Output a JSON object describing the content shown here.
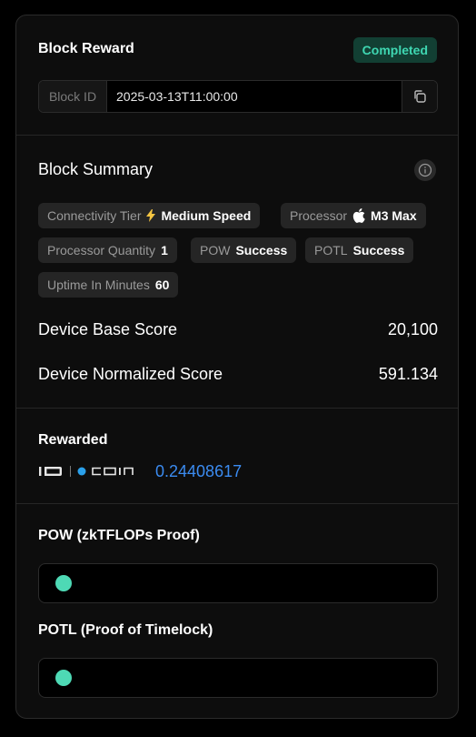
{
  "header": {
    "title": "Block Reward",
    "status": "Completed",
    "block_id_label": "Block ID",
    "block_id_value": "2025-03-13T11:00:00"
  },
  "summary": {
    "title": "Block Summary",
    "tags": [
      {
        "key": "Connectivity Tier",
        "icon": "lightning-icon",
        "value": "Medium Speed"
      },
      {
        "key": "Processor",
        "icon": "apple-icon",
        "value": "M3 Max"
      },
      {
        "key": "Processor Quantity",
        "value": "1"
      },
      {
        "key": "POW",
        "value": "Success"
      },
      {
        "key": "POTL",
        "value": "Success"
      },
      {
        "key": "Uptime In Minutes",
        "value": "60"
      }
    ],
    "device_base_score_label": "Device Base Score",
    "device_base_score_value": "20,100",
    "device_normalized_score_label": "Device Normalized Score",
    "device_normalized_score_value": "591.134"
  },
  "rewarded": {
    "label": "Rewarded",
    "coin_logo_text": "iO | COIN",
    "amount": "0.24408617",
    "amount_color": "#3b8bf0"
  },
  "proofs": {
    "pow_label": "POW (zkTFLOPs Proof)",
    "potl_label": "POTL (Proof of Timelock)",
    "dot_color": "#4ed9b5"
  },
  "colors": {
    "accent_green": "#3fd7b2",
    "badge_bg": "#123f33",
    "lightning": "#f5c542"
  }
}
